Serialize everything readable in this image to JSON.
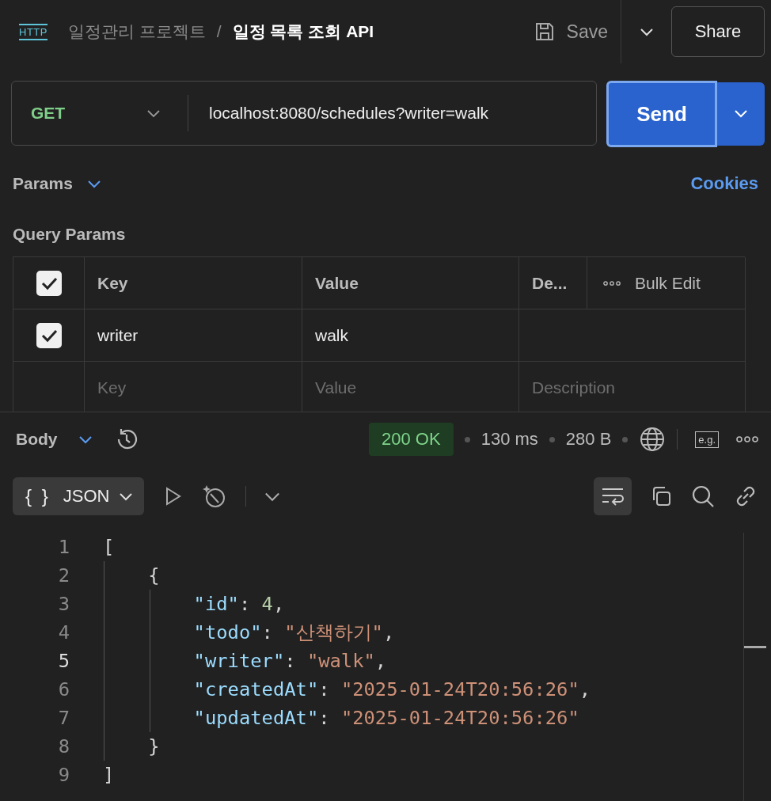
{
  "header": {
    "logo": "HTTP",
    "breadcrumb": [
      {
        "text": "일정관리 프로젝트",
        "current": false
      },
      {
        "text": "일정 목록 조회 API",
        "current": true
      }
    ],
    "separator": "/",
    "save": "Save",
    "share": "Share"
  },
  "request": {
    "method": "GET",
    "url": "localhost:8080/schedules?writer=walk",
    "send": "Send"
  },
  "tabs": {
    "params": "Params",
    "cookies": "Cookies"
  },
  "query_params": {
    "title": "Query Params",
    "header_checked": true,
    "columns": [
      "Key",
      "Value",
      "De..."
    ],
    "bulk_edit": "Bulk Edit",
    "rows": [
      {
        "checked": true,
        "key": "writer",
        "value": "walk"
      }
    ],
    "placeholders": [
      "Key",
      "Value",
      "Description"
    ]
  },
  "response": {
    "view": "Body",
    "status": "200 OK",
    "time": "130 ms",
    "size": "280 B",
    "example": "e.g.",
    "format_icon": "{ }",
    "format": "JSON",
    "wrap_on": true,
    "lines": [
      {
        "number": "1",
        "active": false,
        "tokens": [
          {
            "kind": "punct",
            "text": "["
          }
        ]
      },
      {
        "number": "2",
        "active": false,
        "tokens": [
          {
            "kind": "punct",
            "text": "    {"
          }
        ]
      },
      {
        "number": "3",
        "active": false,
        "tokens": [
          {
            "kind": "key",
            "text": "        \"id\""
          },
          {
            "kind": "punct",
            "text": ": "
          },
          {
            "kind": "number",
            "text": "4"
          },
          {
            "kind": "punct",
            "text": ","
          }
        ]
      },
      {
        "number": "4",
        "active": false,
        "tokens": [
          {
            "kind": "key",
            "text": "        \"todo\""
          },
          {
            "kind": "punct",
            "text": ": "
          },
          {
            "kind": "string",
            "text": "\"산책하기\""
          },
          {
            "kind": "punct",
            "text": ","
          }
        ]
      },
      {
        "number": "5",
        "active": true,
        "tokens": [
          {
            "kind": "key",
            "text": "        \"writer\""
          },
          {
            "kind": "punct",
            "text": ": "
          },
          {
            "kind": "string",
            "text": "\"walk\""
          },
          {
            "kind": "punct",
            "text": ","
          }
        ]
      },
      {
        "number": "6",
        "active": false,
        "tokens": [
          {
            "kind": "key",
            "text": "        \"createdAt\""
          },
          {
            "kind": "punct",
            "text": ": "
          },
          {
            "kind": "string",
            "text": "\"2025-01-24T20:56:26\""
          },
          {
            "kind": "punct",
            "text": ","
          }
        ]
      },
      {
        "number": "7",
        "active": false,
        "tokens": [
          {
            "kind": "key",
            "text": "        \"updatedAt\""
          },
          {
            "kind": "punct",
            "text": ": "
          },
          {
            "kind": "string",
            "text": "\"2025-01-24T20:56:26\""
          }
        ]
      },
      {
        "number": "8",
        "active": false,
        "tokens": [
          {
            "kind": "punct",
            "text": "    }"
          }
        ]
      },
      {
        "number": "9",
        "active": false,
        "tokens": [
          {
            "kind": "punct",
            "text": "]"
          }
        ]
      }
    ]
  }
}
